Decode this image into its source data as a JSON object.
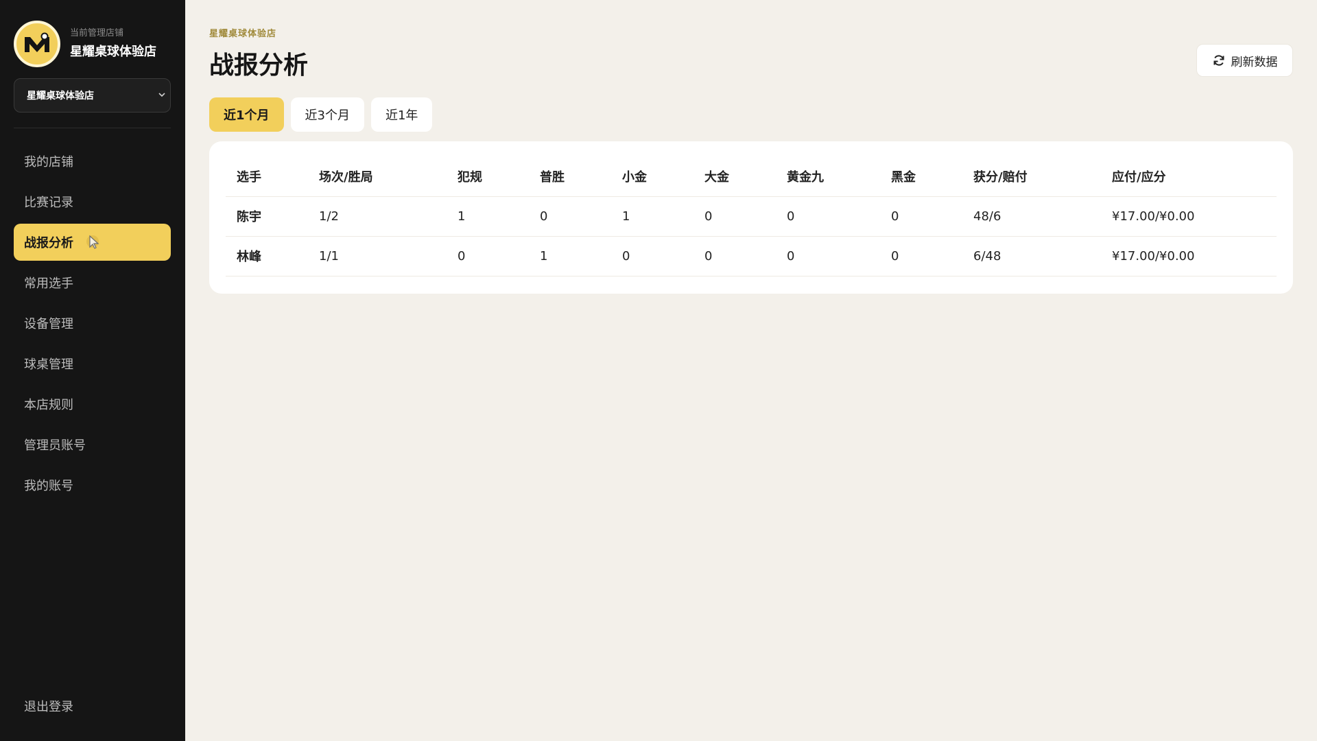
{
  "sidebar": {
    "brand_sub": "当前管理店铺",
    "brand_name": "星耀桌球体验店",
    "logo_letter": "M",
    "store_select": "星耀桌球体验店",
    "nav": [
      {
        "label": "我的店铺"
      },
      {
        "label": "比赛记录"
      },
      {
        "label": "战报分析",
        "active": true
      },
      {
        "label": "常用选手"
      },
      {
        "label": "设备管理"
      },
      {
        "label": "球桌管理"
      },
      {
        "label": "本店规则"
      },
      {
        "label": "管理员账号"
      },
      {
        "label": "我的账号"
      }
    ],
    "logout": "退出登录"
  },
  "header": {
    "breadcrumb": "星耀桌球体验店",
    "title": "战报分析",
    "refresh_label": "刷新数据"
  },
  "tabs": [
    {
      "label": "近1个月",
      "active": true
    },
    {
      "label": "近3个月"
    },
    {
      "label": "近1年"
    }
  ],
  "table": {
    "headers": [
      "选手",
      "场次/胜局",
      "犯规",
      "普胜",
      "小金",
      "大金",
      "黄金九",
      "黑金",
      "获分/赔付",
      "应付/应分"
    ],
    "rows": [
      [
        "陈宇",
        "1/2",
        "1",
        "0",
        "1",
        "0",
        "0",
        "0",
        "48/6",
        "¥17.00/¥0.00"
      ],
      [
        "林峰",
        "1/1",
        "0",
        "1",
        "0",
        "0",
        "0",
        "0",
        "6/48",
        "¥17.00/¥0.00"
      ]
    ]
  },
  "colors": {
    "accent": "#f2cf5b",
    "sidebar_bg": "#151515",
    "page_bg": "#f3f0ea"
  }
}
